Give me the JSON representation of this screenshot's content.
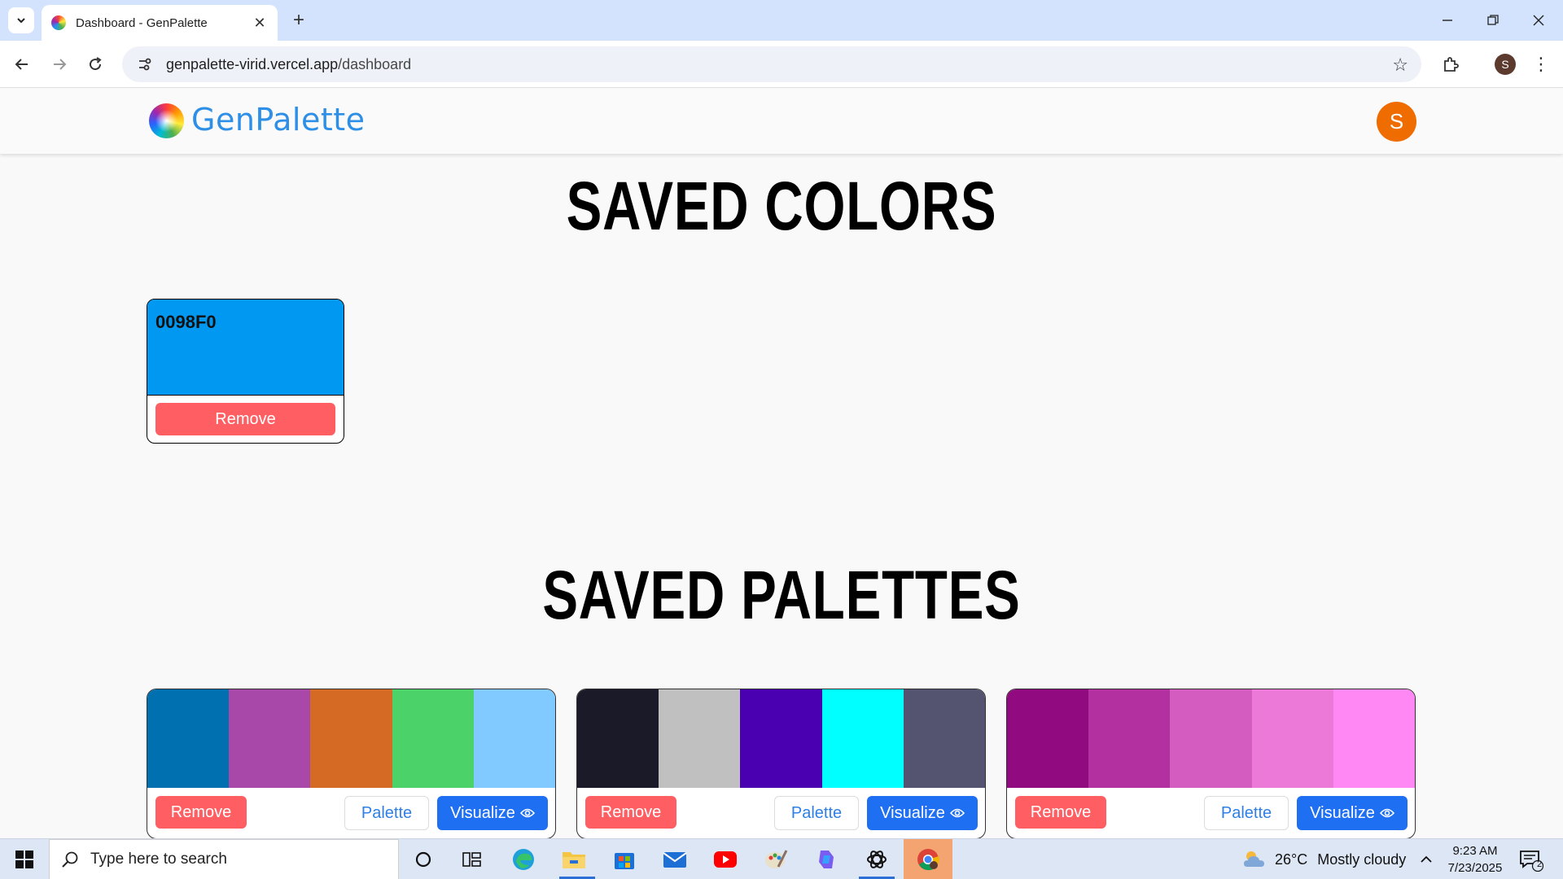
{
  "browser": {
    "tab_title": "Dashboard - GenPalette",
    "url_host": "genpalette-virid.vercel.app",
    "url_path": "/dashboard",
    "profile_initial": "S"
  },
  "app": {
    "brand": "GenPalette",
    "user_initial": "S"
  },
  "saved_colors": {
    "title": "SAVED COLORS",
    "items": [
      {
        "hex": "0098F0",
        "color": "#0098f0",
        "remove_label": "Remove"
      }
    ]
  },
  "saved_palettes": {
    "title": "SAVED PALETTES",
    "remove_label": "Remove",
    "palette_label": "Palette",
    "visualize_label": "Visualize",
    "items": [
      {
        "colors": [
          "#0070b0",
          "#a848a8",
          "#d56a24",
          "#4bd36a",
          "#80caff"
        ]
      },
      {
        "colors": [
          "#1b1a28",
          "#c0c0c0",
          "#4a00b0",
          "#00ffff",
          "#545470"
        ]
      },
      {
        "colors": [
          "#920a80",
          "#b230a0",
          "#d45cc0",
          "#ec78d8",
          "#ff88f4"
        ]
      }
    ]
  },
  "taskbar": {
    "search_placeholder": "Type here to search",
    "weather_temp": "26°C",
    "weather_text": "Mostly cloudy",
    "time": "9:23 AM",
    "date": "7/23/2025",
    "notification_count": "2"
  }
}
